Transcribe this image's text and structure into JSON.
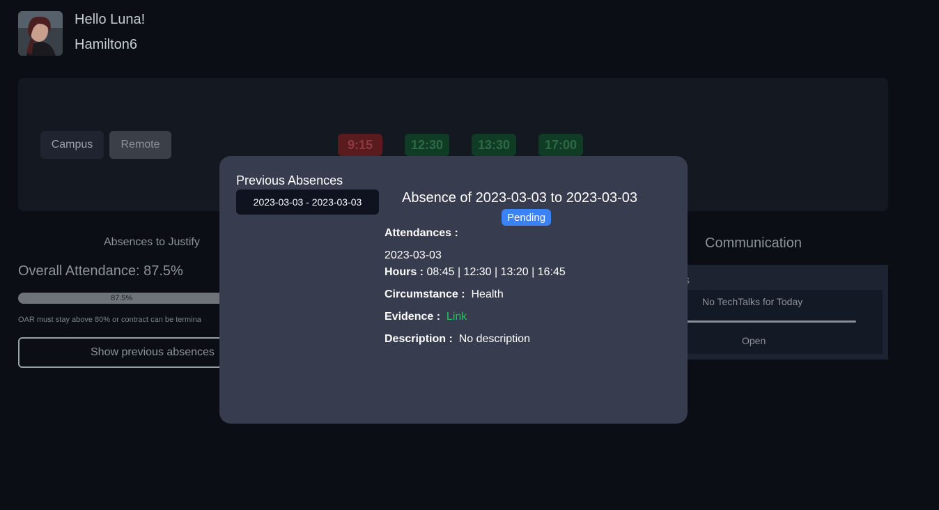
{
  "header": {
    "greeting": "Hello Luna!",
    "username": "Hamilton6"
  },
  "mode_buttons": {
    "campus": "Campus",
    "remote": "Remote"
  },
  "time_slots": [
    {
      "time": "9:15",
      "status_color": "#5a1b1f"
    },
    {
      "time": "12:30",
      "status_color": "#103b24"
    },
    {
      "time": "13:30",
      "status_color": "#103b24"
    },
    {
      "time": "17:00",
      "status_color": "#103b24"
    }
  ],
  "absences": {
    "title": "Absences to Justify",
    "overall_label": "Overall Attendance: 87.5%",
    "progress_value": 87.5,
    "progress_text": "87.5%",
    "note": "OAR must stay above 80% or contract can be termina",
    "show_previous": "Show previous absences"
  },
  "communication": {
    "title": "Communication",
    "partial_text": "s",
    "no_talks": "No TechTalks for Today",
    "open": "Open"
  },
  "modal": {
    "previous_heading": "Previous Absences",
    "date_range": "2023-03-03 - 2023-03-03",
    "heading": "Absence of 2023-03-03 to 2023-03-03",
    "status": "Pending",
    "attendances_label": "Attendances :",
    "attendance_date": "2023-03-03",
    "hours_label": "Hours :",
    "hours_value": "08:45 | 12:30 | 13:20 | 16:45",
    "circumstance_label": "Circumstance :",
    "circumstance_value": "Health",
    "evidence_label": "Evidence :",
    "evidence_value": "Link",
    "description_label": "Description :",
    "description_value": "No description"
  },
  "colors": {
    "background": "#0b0e15",
    "modal": "#383c4f",
    "pending": "#3b82f6",
    "link": "#22c55e"
  }
}
